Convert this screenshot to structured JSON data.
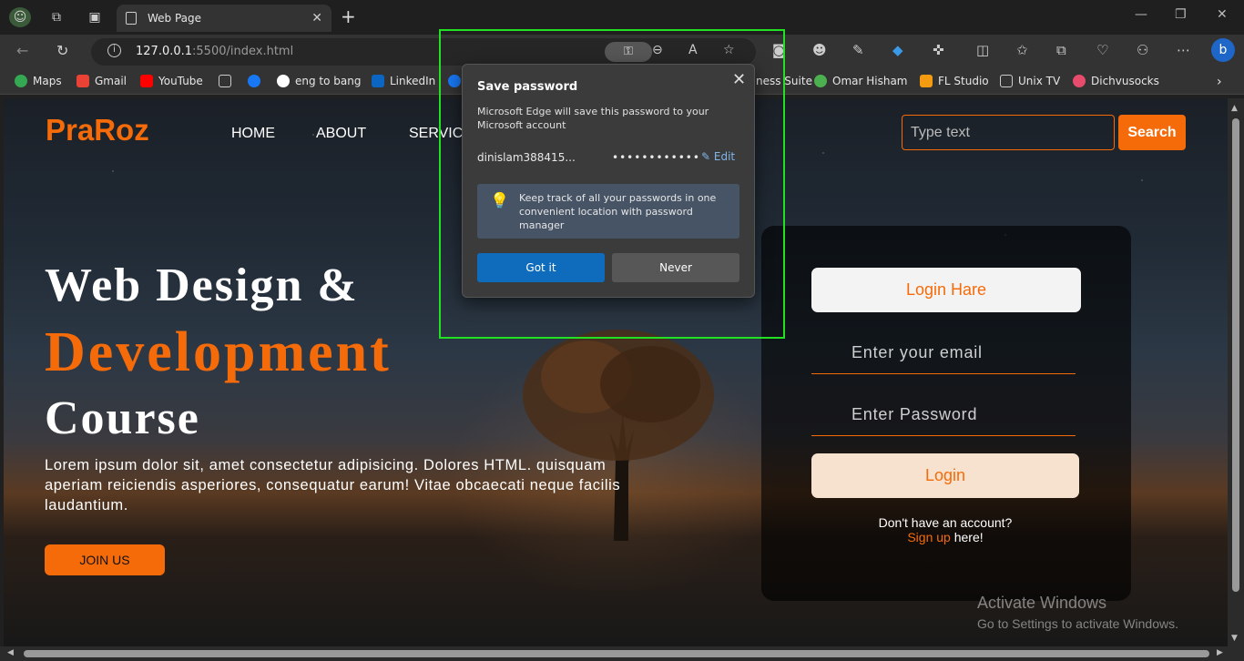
{
  "browser": {
    "tab_title": "Web Page",
    "url_host": "127.0.0.1",
    "url_rest": ":5500/index.html",
    "bookmarks": [
      "Maps",
      "Gmail",
      "YouTube",
      "eng to bang",
      "LinkedIn",
      "ness Suite",
      "Omar Hisham",
      "FL Studio",
      "Unix TV",
      "Dichvusocks"
    ],
    "icons": {
      "back": "back-arrow-icon",
      "refresh": "refresh-icon",
      "close": "close-icon",
      "new_tab": "plus-icon"
    }
  },
  "site": {
    "logo": "PraRoz",
    "nav": [
      "HOME",
      "ABOUT",
      "SERVIC"
    ],
    "search_placeholder": "Type text",
    "search_button": "Search",
    "hero_line1": "Web Design &",
    "hero_line2": "Development",
    "hero_line3": "Course",
    "description": "Lorem ipsum dolor sit, amet consectetur adipisicing. Dolores HTML. quisquam aperiam reiciendis asperiores, consequatur earum! Vitae obcaecati neque facilis laudantium.",
    "join_button": "JOIN US",
    "accent_color": "#f56b0a"
  },
  "login": {
    "title": "Login Hare",
    "email_placeholder": "Enter your email",
    "password_placeholder": "Enter Password",
    "button": "Login",
    "no_account": "Don't have an account?",
    "signup_link": "Sign up",
    "signup_suffix": " here!"
  },
  "watermark": {
    "line1": "Activate Windows",
    "line2": "Go to Settings to activate Windows."
  },
  "save_password_popup": {
    "title": "Save password",
    "message": "Microsoft Edge will save this password to your Microsoft account",
    "username": "dinislam388415...",
    "password_mask": "••••••••••••",
    "edit_label": "Edit",
    "tip": "Keep track of all your passwords in one convenient location with password manager",
    "got_it": "Got it",
    "never": "Never",
    "primary_color": "#0f6cbd"
  }
}
